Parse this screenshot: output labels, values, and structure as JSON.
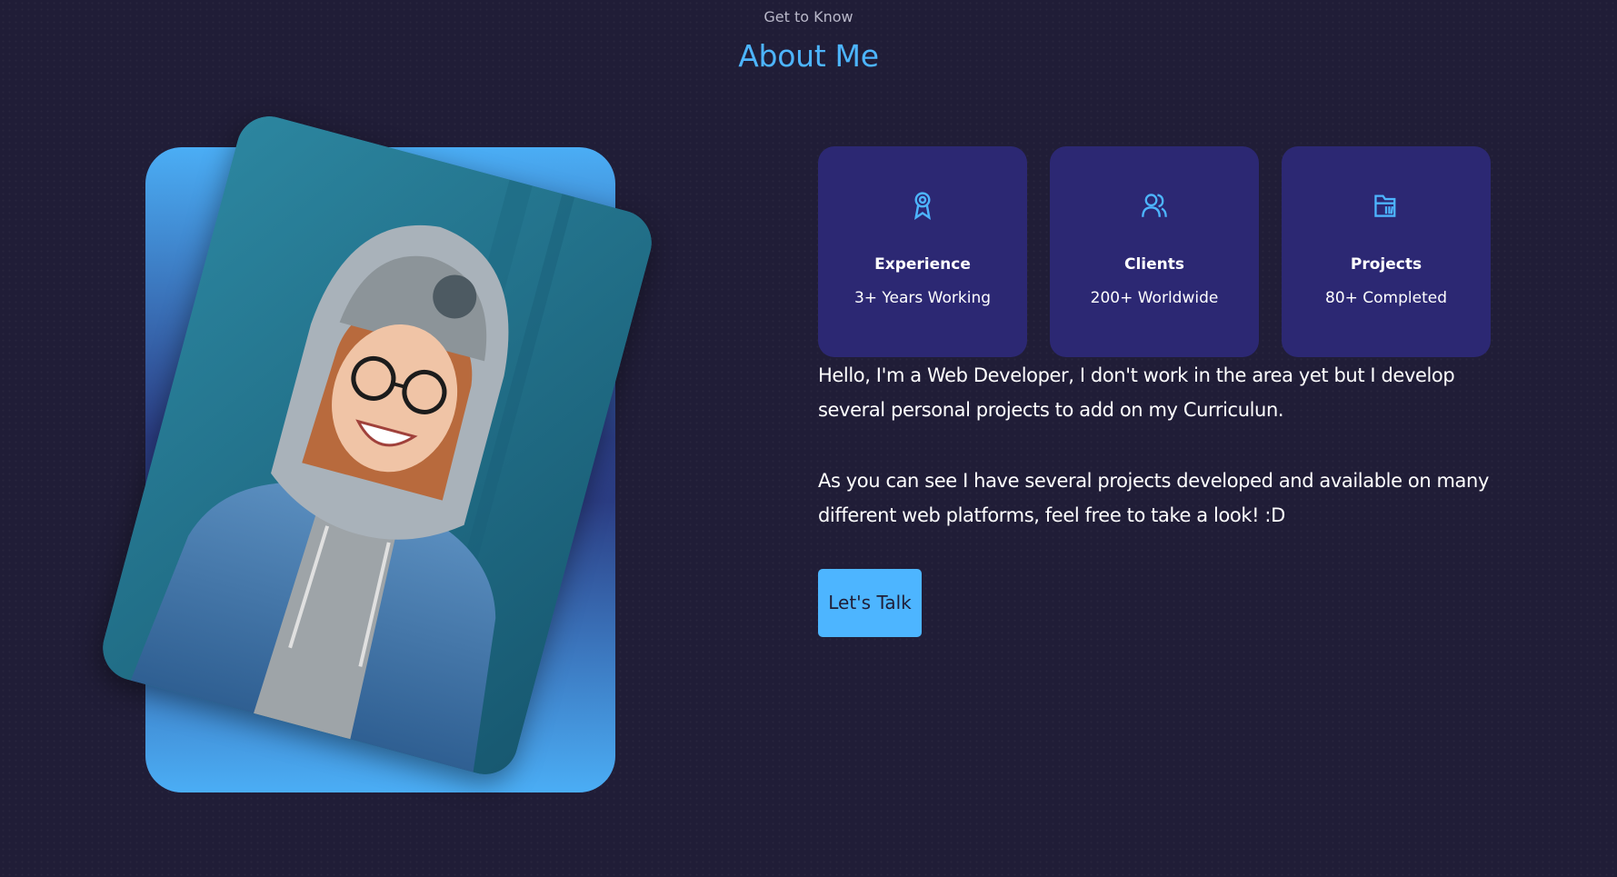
{
  "header": {
    "eyebrow": "Get to Know",
    "title": "About Me"
  },
  "photo": {
    "alt": "Smiling person wearing a beanie, glasses and denim jacket against a teal wall"
  },
  "cards": [
    {
      "icon": "award-icon",
      "title": "Experience",
      "subtitle": "3+ Years Working"
    },
    {
      "icon": "users-icon",
      "title": "Clients",
      "subtitle": "200+ Worldwide"
    },
    {
      "icon": "folder-icon",
      "title": "Projects",
      "subtitle": "80+ Completed"
    }
  ],
  "about": {
    "paragraph1": "Hello, I'm a Web Developer, I don't work in the area yet but I develop several personal projects to add on my Curriculun.",
    "paragraph2": "As you can see I have several projects developed and available on many different web platforms, feel free to take a look! :D"
  },
  "cta": {
    "label": "Let's Talk"
  },
  "colors": {
    "background": "#201d37",
    "accent": "#4db5ff",
    "card": "#2c2873"
  }
}
